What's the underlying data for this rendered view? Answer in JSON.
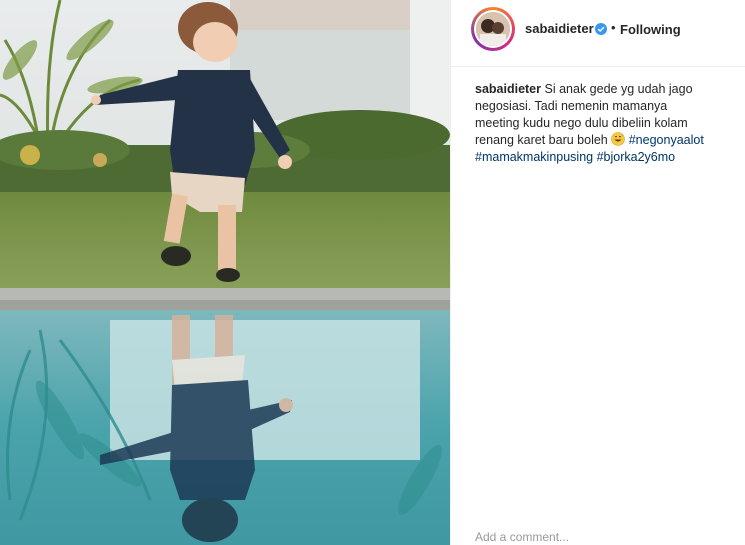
{
  "post": {
    "username": "sabaidieter",
    "separator": "•",
    "follow_state": "Following",
    "caption": {
      "username": "sabaidieter",
      "text_line1": "Si anak gede yg udah jago",
      "text_line2": "negosiasi. Tadi nemenin mamanya meeting",
      "text_line3": "kudu nego dulu dibeliin kolam renang",
      "text_line4": "karet baru boleh",
      "hashtags": [
        "#negonyaalot",
        "#mamakmakinpusing",
        "#bjorka2y6mo"
      ]
    },
    "comment_placeholder": "Add a comment..."
  },
  "colors": {
    "verified_badge": "#3897f0",
    "hashtag": "#003569",
    "story_ring": [
      "#f58529",
      "#dd2a7b",
      "#8134af"
    ]
  },
  "icons": {
    "verified": "verified-badge-icon",
    "emoji": "grinning-sweat-emoji"
  }
}
